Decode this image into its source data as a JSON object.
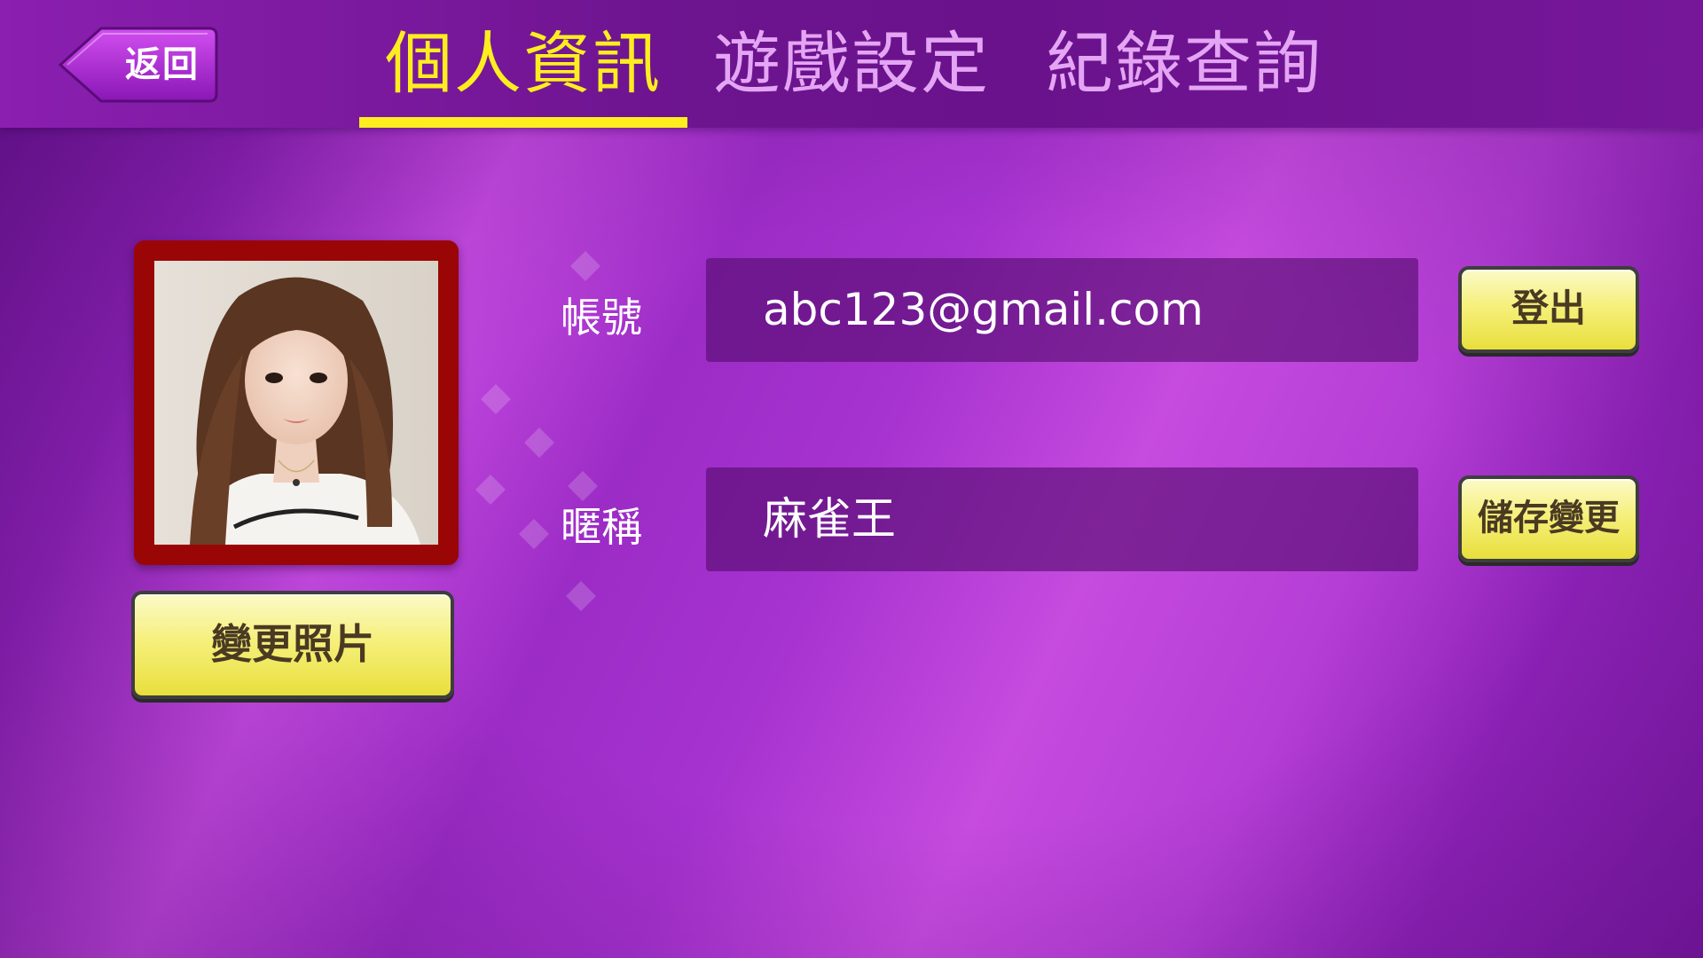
{
  "header": {
    "back_label": "返回",
    "tabs": [
      {
        "label": "個人資訊",
        "active": true
      },
      {
        "label": "遊戲設定",
        "active": false
      },
      {
        "label": "紀錄查詢",
        "active": false
      }
    ]
  },
  "profile": {
    "change_photo_label": "變更照片",
    "account": {
      "label": "帳號",
      "value": "abc123@gmail.com"
    },
    "nickname": {
      "label": "暱稱",
      "value": "麻雀王"
    },
    "logout_label": "登出",
    "save_label": "儲存變更"
  },
  "colors": {
    "accent": "#ffee1f",
    "inactive_tab": "#e4a5f4",
    "avatar_frame": "#9a0606",
    "button_yellow": "#f6f07d"
  }
}
